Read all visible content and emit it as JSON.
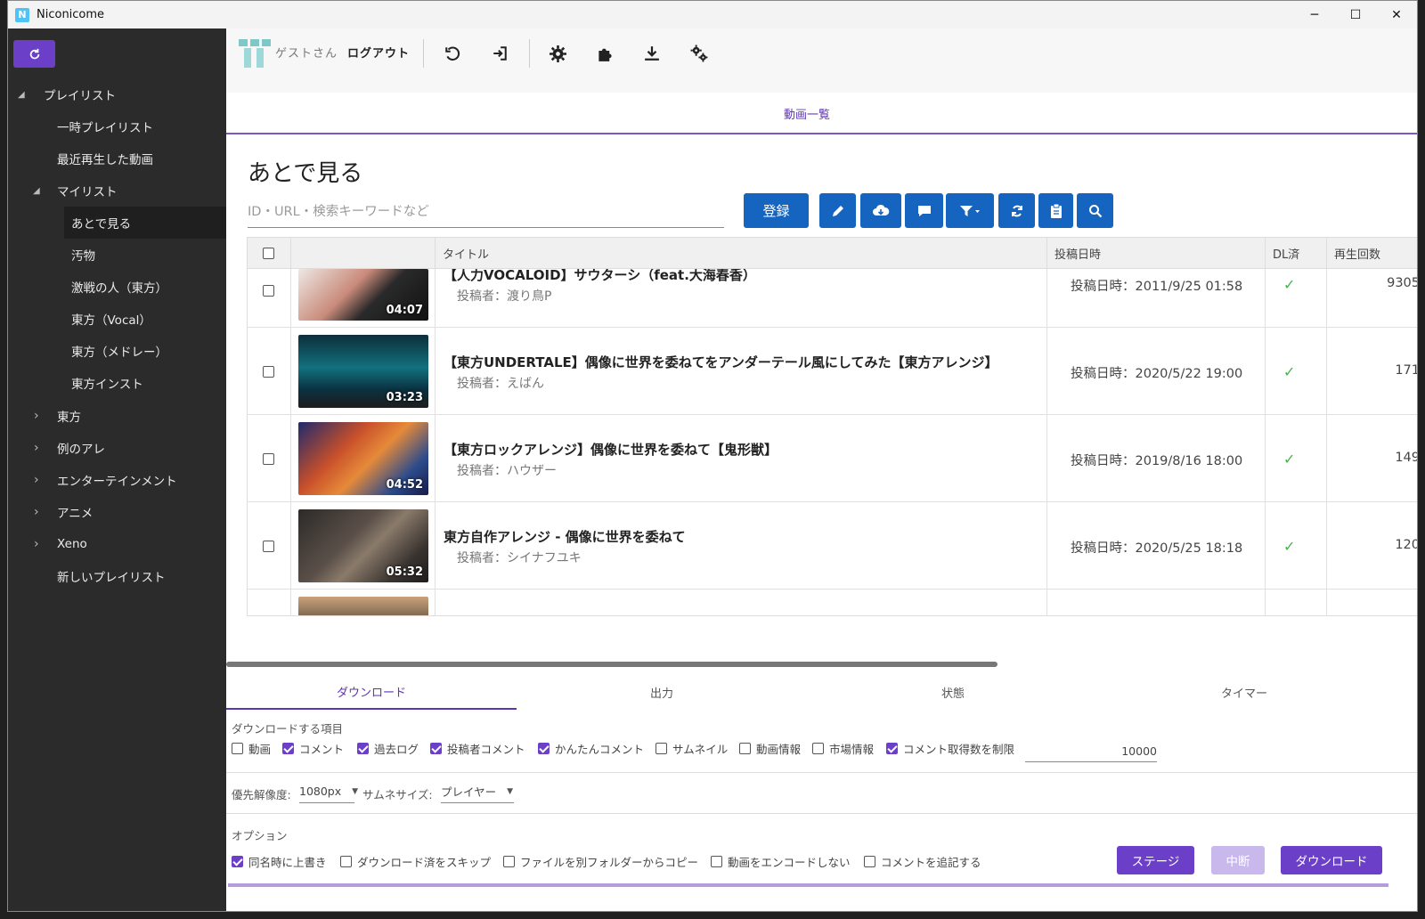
{
  "window": {
    "title": "Niconicome",
    "app_icon_letter": "N"
  },
  "sidebar": {
    "refresh_icon": "refresh-icon",
    "items": [
      {
        "label": "プレイリスト",
        "arrow": "◢"
      },
      {
        "label": "一時プレイリスト"
      },
      {
        "label": "最近再生した動画"
      },
      {
        "label": "マイリスト",
        "arrow": "◢"
      },
      {
        "label": "あとで見る"
      },
      {
        "label": "汚物"
      },
      {
        "label": "激戦の人（東方）"
      },
      {
        "label": "東方（Vocal）"
      },
      {
        "label": "東方（メドレー）"
      },
      {
        "label": "東方インスト"
      },
      {
        "label": "東方",
        "arrow": "›"
      },
      {
        "label": "例のアレ",
        "arrow": "›"
      },
      {
        "label": "エンターテインメント",
        "arrow": "›"
      },
      {
        "label": "アニメ",
        "arrow": "›"
      },
      {
        "label": "Xeno",
        "arrow": "›"
      },
      {
        "label": "新しいプレイリスト"
      }
    ]
  },
  "toolbar": {
    "user": "ゲストさん",
    "logout": "ログアウト",
    "icons": [
      "undo-icon",
      "sign-out-icon",
      "gear-icon",
      "puzzle-icon",
      "download-icon",
      "gears-icon"
    ]
  },
  "page_tab": "動画一覧",
  "list": {
    "title": "あとで見る",
    "search_placeholder": "ID・URL・検索キーワードなど",
    "register_button": "登録",
    "action_icons": [
      "pencil-icon",
      "cloud-download-icon",
      "comment-icon",
      "filter-icon",
      "sync-icon",
      "clipboard-icon",
      "search-icon"
    ]
  },
  "table": {
    "headers": {
      "title": "タイトル",
      "date": "投稿日時",
      "dl": "DL済",
      "plays": "再生回数"
    },
    "rows": [
      {
        "title": "【人力VOCALOID】サウターシ（feat.大海春香）",
        "author": "投稿者：渡り鳥P",
        "date": "投稿日時：2011/9/25 01:58",
        "dl": "✓",
        "plays": "9305",
        "duration": "04:07",
        "thumb_bg": "#e8e0dc"
      },
      {
        "title": "【東方UNDERTALE】偶像に世界を委ねてをアンダーテール風にしてみた【東方アレンジ】",
        "author": "投稿者：えばん",
        "date": "投稿日時：2020/5/22 19:00",
        "dl": "✓",
        "plays": "171",
        "duration": "03:23",
        "thumb_bg": "#0d4d5c"
      },
      {
        "title": "【東方ロックアレンジ】偶像に世界を委ねて【鬼形獣】",
        "author": "投稿者：ハウザー",
        "date": "投稿日時：2019/8/16 18:00",
        "dl": "✓",
        "plays": "149",
        "duration": "04:52",
        "thumb_bg": "#b3472a"
      },
      {
        "title": "東方自作アレンジ - 偶像に世界を委ねて",
        "author": "投稿者：シイナフユキ",
        "date": "投稿日時：2020/5/25 18:18",
        "dl": "✓",
        "plays": "120",
        "duration": "05:32",
        "thumb_bg": "#3c3a36"
      }
    ]
  },
  "bottom_tabs": [
    "ダウンロード",
    "出力",
    "状態",
    "タイマー"
  ],
  "download": {
    "items_label": "ダウンロードする項目",
    "items": [
      {
        "label": "動画",
        "checked": false
      },
      {
        "label": "コメント",
        "checked": true
      },
      {
        "label": "過去ログ",
        "checked": true
      },
      {
        "label": "投稿者コメント",
        "checked": true
      },
      {
        "label": "かんたんコメント",
        "checked": true
      },
      {
        "label": "サムネイル",
        "checked": false
      },
      {
        "label": "動画情報",
        "checked": false
      },
      {
        "label": "市場情報",
        "checked": false
      },
      {
        "label": "コメント取得数を制限",
        "checked": true
      }
    ],
    "comment_limit": "10000",
    "resolution_label": "優先解像度:",
    "resolution_value": "1080px",
    "thumb_size_label": "サムネサイズ:",
    "thumb_size_value": "プレイヤー",
    "options_label": "オプション",
    "options": [
      {
        "label": "同名時に上書き",
        "checked": true
      },
      {
        "label": "ダウンロード済をスキップ",
        "checked": false
      },
      {
        "label": "ファイルを別フォルダーからコピー",
        "checked": false
      },
      {
        "label": "動画をエンコードしない",
        "checked": false
      },
      {
        "label": "コメントを追記する",
        "checked": false
      }
    ],
    "stage_button": "ステージ",
    "abort_button": "中断",
    "download_button": "ダウンロード"
  }
}
